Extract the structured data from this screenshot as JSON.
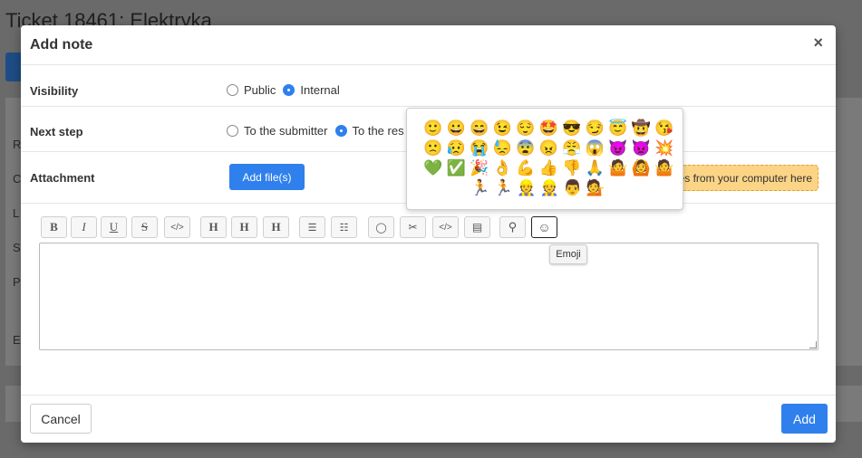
{
  "background": {
    "title": "Ticket 18461: Elektryka",
    "side_letters": [
      "R",
      "C",
      "L",
      "S",
      "P",
      "E"
    ]
  },
  "modal": {
    "title": "Add note",
    "close_label": "×"
  },
  "visibility": {
    "label": "Visibility",
    "options": [
      {
        "label": "Public",
        "checked": false
      },
      {
        "label": "Internal",
        "checked": true
      }
    ]
  },
  "next_step": {
    "label": "Next step",
    "options": [
      {
        "label": "To the submitter",
        "checked": false
      },
      {
        "label": "To the res",
        "checked": true
      }
    ]
  },
  "attachment": {
    "label": "Attachment",
    "button_label": "Add file(s)",
    "drop_text": "es from your computer here"
  },
  "toolbar": {
    "buttons": [
      {
        "name": "bold-button",
        "glyph": "B"
      },
      {
        "name": "italic-button",
        "glyph": "I"
      },
      {
        "name": "underline-button",
        "glyph": "U"
      },
      {
        "name": "strikethrough-button",
        "glyph": "S"
      },
      {
        "name": "code-button",
        "glyph": "</>"
      },
      {
        "name": "heading1-button",
        "glyph": "H"
      },
      {
        "name": "heading2-button",
        "glyph": "H"
      },
      {
        "name": "heading3-button",
        "glyph": "H"
      },
      {
        "name": "bullet-list-button",
        "glyph": "☰"
      },
      {
        "name": "numbered-list-button",
        "glyph": "☷"
      },
      {
        "name": "quote-button",
        "glyph": "◯"
      },
      {
        "name": "cut-button",
        "glyph": "✂"
      },
      {
        "name": "code-block-button",
        "glyph": "</>"
      },
      {
        "name": "document-button",
        "glyph": "▤"
      },
      {
        "name": "search-button",
        "glyph": "⚲"
      },
      {
        "name": "emoji-button",
        "glyph": "☺"
      }
    ]
  },
  "emoji_tooltip": "Emoji",
  "emoji_picker": {
    "rows": [
      [
        "🙂",
        "😀",
        "😄",
        "😉",
        "😌",
        "🤩",
        "😎",
        "😏",
        "😇",
        "🤠",
        "😘"
      ],
      [
        "🙁",
        "😥",
        "😭",
        "😓",
        "😨",
        "😠",
        "😤",
        "😱",
        "😈",
        "👿",
        "💥"
      ],
      [
        "💚",
        "✅",
        "🎉",
        "👌",
        "💪",
        "👍",
        "👎",
        "🙏",
        "🤷",
        "🙆",
        "🤷"
      ],
      [
        "🏃",
        "🏃",
        "👷",
        "👷",
        "👨",
        "💁"
      ]
    ]
  },
  "footer": {
    "cancel_label": "Cancel",
    "add_label": "Add"
  }
}
